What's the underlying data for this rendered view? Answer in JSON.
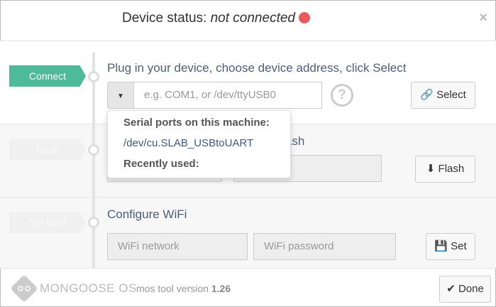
{
  "header": {
    "title_prefix": "Device status:",
    "status": "not connected",
    "status_color": "#ea5a5a",
    "close": "×"
  },
  "steps": [
    {
      "label": "Connect",
      "heading": "Plug in your device, choose device address, click Select",
      "input_placeholder": "e.g. COM1, or /dev/ttyUSB0",
      "help": "?",
      "button": "Select"
    },
    {
      "label": "Flash",
      "heading_visible": "ck Flash",
      "input_visible": "...",
      "button": "Flash"
    },
    {
      "label": "Set WiFi",
      "heading": "Configure WiFi",
      "network_placeholder": "WiFi network",
      "password_placeholder": "WiFi password",
      "button": "Set"
    }
  ],
  "dropdown": {
    "ports_header": "Serial ports on this machine:",
    "ports": [
      "/dev/cu.SLAB_USBtoUART"
    ],
    "recent_header": "Recently used:"
  },
  "footer": {
    "brand": "MONGOOSE OS",
    "version_label": "mos tool version",
    "version": "1.26",
    "done": "Done"
  },
  "colors": {
    "accent": "#4dba98",
    "heading": "#4d5e79"
  }
}
